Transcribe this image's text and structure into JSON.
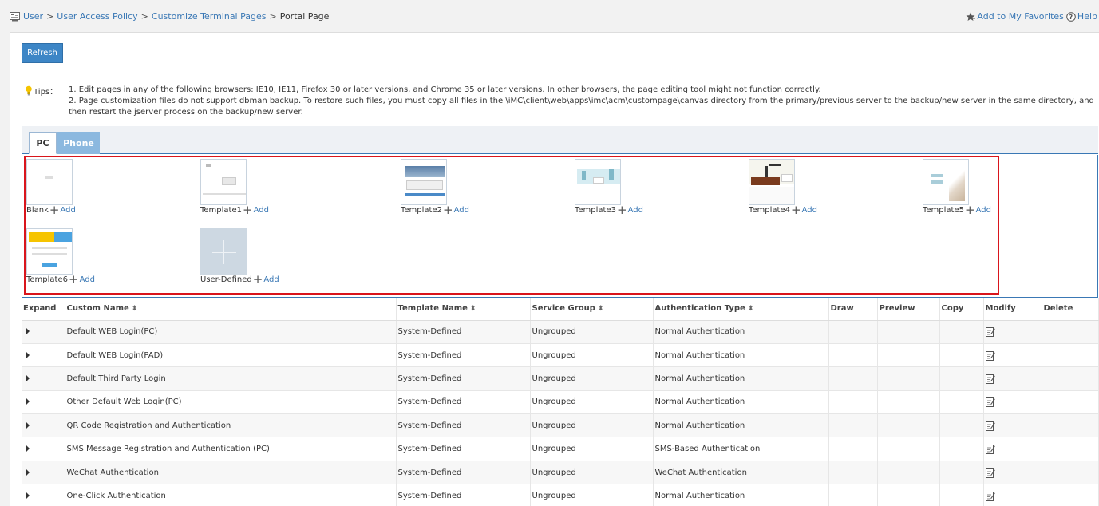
{
  "breadcrumb": {
    "items": [
      "User",
      "User Access Policy",
      "Customize Terminal Pages"
    ],
    "current": "Portal Page",
    "separator": ">"
  },
  "top_links": {
    "favorites": "Add to My Favorites",
    "help": "Help"
  },
  "toolbar": {
    "refresh_label": "Refresh"
  },
  "tips": {
    "label": "Tips：",
    "lines": [
      "1. Edit pages in any of the following browsers: IE10, IE11, Firefox 30 or later versions, and Chrome 35 or later versions. In other browsers, the page editing tool might not function correctly.",
      "2. Page customization files do not support dbman backup. To restore such files, you must copy all files in the \\iMC\\client\\web\\apps\\imc\\acm\\custompage\\canvas directory from the primary/previous server to the backup/new server in the same directory, and then restart the jserver process on the backup/new server."
    ]
  },
  "tabs": [
    {
      "label": "PC",
      "active": true
    },
    {
      "label": "Phone",
      "active": false
    }
  ],
  "templates": [
    {
      "name": "Blank",
      "add": "Add"
    },
    {
      "name": "Template1",
      "add": "Add"
    },
    {
      "name": "Template2",
      "add": "Add"
    },
    {
      "name": "Template3",
      "add": "Add"
    },
    {
      "name": "Template4",
      "add": "Add"
    },
    {
      "name": "Template5",
      "add": "Add"
    },
    {
      "name": "Template6",
      "add": "Add"
    },
    {
      "name": "User-Defined",
      "add": "Add"
    }
  ],
  "table": {
    "columns": [
      "Expand",
      "Custom Name",
      "Template Name",
      "Service Group",
      "Authentication Type",
      "Draw",
      "Preview",
      "Copy",
      "Modify",
      "Delete"
    ],
    "rows": [
      {
        "custom_name": "Default WEB Login(PC)",
        "template_name": "System-Defined",
        "service_group": "Ungrouped",
        "auth_type": "Normal Authentication"
      },
      {
        "custom_name": "Default WEB Login(PAD)",
        "template_name": "System-Defined",
        "service_group": "Ungrouped",
        "auth_type": "Normal Authentication"
      },
      {
        "custom_name": "Default Third Party Login",
        "template_name": "System-Defined",
        "service_group": "Ungrouped",
        "auth_type": "Normal Authentication"
      },
      {
        "custom_name": "Other Default Web Login(PC)",
        "template_name": "System-Defined",
        "service_group": "Ungrouped",
        "auth_type": "Normal Authentication"
      },
      {
        "custom_name": "QR Code Registration and Authentication",
        "template_name": "System-Defined",
        "service_group": "Ungrouped",
        "auth_type": "Normal Authentication"
      },
      {
        "custom_name": "SMS Message Registration and Authentication (PC)",
        "template_name": "System-Defined",
        "service_group": "Ungrouped",
        "auth_type": "SMS-Based Authentication"
      },
      {
        "custom_name": "WeChat Authentication",
        "template_name": "System-Defined",
        "service_group": "Ungrouped",
        "auth_type": "WeChat Authentication"
      },
      {
        "custom_name": "One-Click Authentication",
        "template_name": "System-Defined",
        "service_group": "Ungrouped",
        "auth_type": "Normal Authentication"
      }
    ]
  },
  "colors": {
    "link": "#3a78b5",
    "button": "#3d86c6",
    "highlight_box": "#d9151c",
    "tab_inactive": "#8bb8df"
  }
}
